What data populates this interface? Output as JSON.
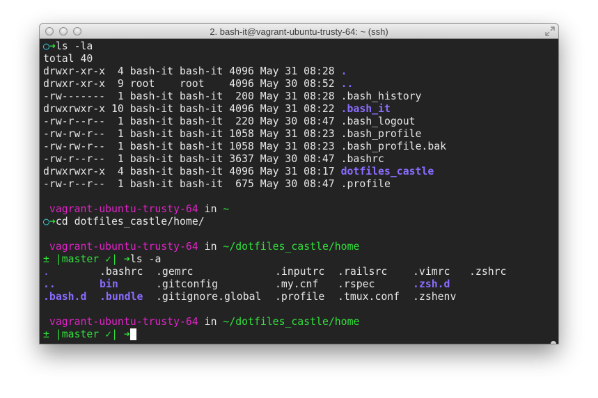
{
  "window": {
    "title": "2. bash-it@vagrant-ubuntu-trusty-64: ~ (ssh)"
  },
  "icons": {
    "prompt_circle": "○",
    "arrow": "➜",
    "plusminus": "±",
    "bar": "|",
    "check": "✓"
  },
  "lines": {
    "cmd1": "ls -la",
    "total": "total 40",
    "ls_rows": [
      {
        "meta": "drwxr-xr-x  4 bash-it bash-it 4096 May 31 08:28 ",
        "name": "."
      },
      {
        "meta": "drwxr-xr-x  9 root    root    4096 May 30 08:52 ",
        "name": ".."
      },
      {
        "meta": "-rw-------  1 bash-it bash-it  200 May 31 08:28 ",
        "name": ".bash_history"
      },
      {
        "meta": "drwxrwxr-x 10 bash-it bash-it 4096 May 31 08:22 ",
        "name": ".bash_it"
      },
      {
        "meta": "-rw-r--r--  1 bash-it bash-it  220 May 30 08:47 ",
        "name": ".bash_logout"
      },
      {
        "meta": "-rw-rw-r--  1 bash-it bash-it 1058 May 31 08:23 ",
        "name": ".bash_profile"
      },
      {
        "meta": "-rw-rw-r--  1 bash-it bash-it 1058 May 31 08:23 ",
        "name": ".bash_profile.bak"
      },
      {
        "meta": "-rw-r--r--  1 bash-it bash-it 3637 May 30 08:47 ",
        "name": ".bashrc"
      },
      {
        "meta": "drwxrwxr-x  4 bash-it bash-it 4096 May 31 08:17 ",
        "name": "dotfiles_castle"
      },
      {
        "meta": "-rw-r--r--  1 bash-it bash-it  675 May 30 08:47 ",
        "name": ".profile"
      }
    ],
    "host": "vagrant-ubuntu-trusty-64",
    "in": "in",
    "path1": "~",
    "cmd2": "cd dotfiles_castle/home/",
    "path2": "~/dotfiles_castle/home",
    "branch": "master",
    "cmd3": "ls -a",
    "ls_a": {
      "row1": [
        ".",
        ".bashrc",
        ".gemrc",
        ".inputrc",
        ".railsrc",
        ".vimrc",
        ".zshrc"
      ],
      "row2": [
        "..",
        "bin",
        ".gitconfig",
        ".my.cnf",
        ".rspec",
        ".zsh.d"
      ],
      "row3": [
        ".bash.d",
        ".bundle",
        ".gitignore.global",
        ".profile",
        ".tmux.conf",
        ".zshenv"
      ]
    }
  }
}
